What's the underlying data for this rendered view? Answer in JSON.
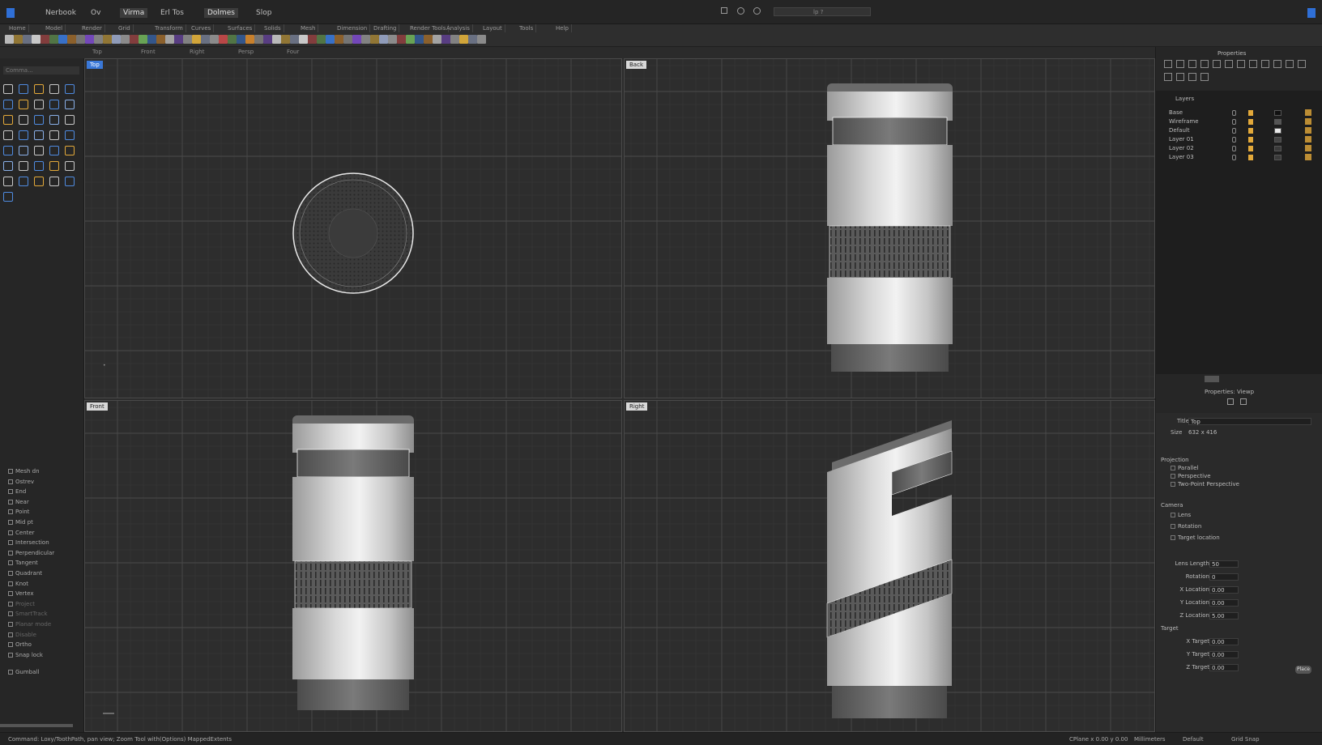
{
  "app": {
    "title": "",
    "zoom_field": "lp ?",
    "accent": "#2f6fd6"
  },
  "menu": [
    {
      "label": "Nerbook",
      "active": false
    },
    {
      "label": "Ov",
      "active": false
    },
    {
      "label": "Virma",
      "active": true
    },
    {
      "label": "Erl Tos",
      "active": false
    },
    {
      "label": "Dolmes",
      "active": true
    },
    {
      "label": "Slop",
      "active": false
    }
  ],
  "tabs": [
    "Home",
    "Model",
    "Render",
    "Grid",
    "Transform",
    "Curves",
    "Surfaces",
    "Solids",
    "Mesh",
    "Dimension",
    "Drafting",
    "Render Tools",
    "Analysis",
    "Layout",
    "Tools",
    "Help"
  ],
  "viewtabs": [
    "Top",
    "Front",
    "Right",
    "Persp",
    "Four"
  ],
  "left_panel": {
    "search_placeholder": "Comma...",
    "tree": [
      {
        "label": "Mesh dn",
        "dim": false
      },
      {
        "label": "Ostrev",
        "dim": false
      },
      {
        "label": "End",
        "dim": false
      },
      {
        "label": "Near",
        "dim": false
      },
      {
        "label": "Point",
        "dim": false
      },
      {
        "label": "Mid pt",
        "dim": false
      },
      {
        "label": "Center",
        "dim": false
      },
      {
        "label": "Intersection",
        "dim": false
      },
      {
        "label": "Perpendicular",
        "dim": false
      },
      {
        "label": "Tangent",
        "dim": false
      },
      {
        "label": "Quadrant",
        "dim": false
      },
      {
        "label": "Knot",
        "dim": false
      },
      {
        "label": "Vertex",
        "dim": false
      },
      {
        "label": "Project",
        "dim": true
      },
      {
        "label": "SmartTrack",
        "dim": true
      },
      {
        "label": "Planar mode",
        "dim": true
      },
      {
        "label": "Disable",
        "dim": true
      },
      {
        "label": "Ortho",
        "dim": false
      },
      {
        "label": "Snap lock",
        "dim": false
      },
      {
        "label": "Gumball",
        "dim": false
      }
    ]
  },
  "viewports": [
    {
      "label": "Top",
      "active": true
    },
    {
      "label": "Back",
      "active": false
    },
    {
      "label": "Front",
      "active": false
    },
    {
      "label": "Right",
      "active": false
    }
  ],
  "right_panel": {
    "header": "Properties",
    "layers_title": "Layers",
    "layers": [
      {
        "name": "Base",
        "color": "#111111"
      },
      {
        "name": "Wireframe",
        "color": "#555555"
      },
      {
        "name": "Default",
        "color": "#e8e8e8"
      },
      {
        "name": "Layer 01",
        "color": "#444444"
      },
      {
        "name": "Layer 02",
        "color": "#3a3a3a"
      },
      {
        "name": "Layer 03",
        "color": "#3a3a3a"
      }
    ],
    "props_title": "Properties: Viewp",
    "title_label": "Title",
    "title_value": "Top",
    "size_label": "Size",
    "size_value": "632 x 416",
    "projection_label": "Projection",
    "projection_options": [
      "Parallel",
      "Perspective",
      "Two-Point Perspective"
    ],
    "camera_label": "Camera",
    "camera_options": [
      "Lens",
      "Rotation",
      "Target location"
    ],
    "values": [
      {
        "label": "Lens Length",
        "value": "50"
      },
      {
        "label": "Rotation",
        "value": "0"
      },
      {
        "label": "X Location",
        "value": "0.00"
      },
      {
        "label": "Y Location",
        "value": "0.00"
      },
      {
        "label": "Z Location",
        "value": "5.00"
      }
    ],
    "target_label": "Target",
    "target_values": [
      {
        "label": "X Target",
        "value": "0.00"
      },
      {
        "label": "Y Target",
        "value": "0.00"
      },
      {
        "label": "Z Target",
        "value": "0.00"
      }
    ],
    "place_button": "Place"
  },
  "status": {
    "left": "Command: Loxy/ToothPath, pan view; Zoom Tool with(Options) MappedExtents",
    "right_items": [
      "CPlane x 0.00 y 0.00",
      "Millimeters",
      "Default",
      "Grid Snap"
    ]
  }
}
